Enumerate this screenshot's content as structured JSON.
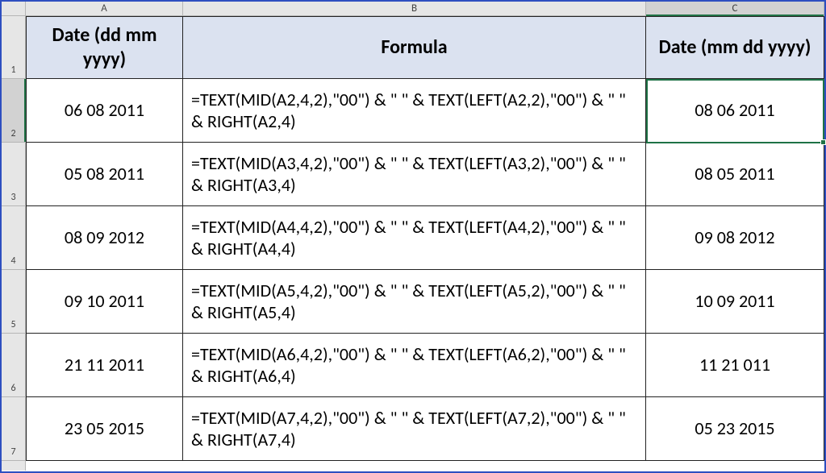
{
  "columns": {
    "letters": [
      "A",
      "B",
      "C"
    ],
    "selected_index": 2
  },
  "row_headers": {
    "numbers": [
      "1",
      "2",
      "3",
      "4",
      "5",
      "6",
      "7"
    ],
    "selected_index": 1
  },
  "header": {
    "colA": "Date (dd mm yyyy)",
    "colB": "Formula",
    "colC": "Date (mm dd yyyy)"
  },
  "rows": [
    {
      "date_in": "06 08 2011",
      "formula": "=TEXT(MID(A2,4,2),\"00\") & \" \" & TEXT(LEFT(A2,2),\"00\") & \" \" & RIGHT(A2,4)",
      "date_out": "08 06 2011"
    },
    {
      "date_in": "05 08 2011",
      "formula": "=TEXT(MID(A3,4,2),\"00\") & \" \" & TEXT(LEFT(A3,2),\"00\") & \" \" & RIGHT(A3,4)",
      "date_out": "08 05 2011"
    },
    {
      "date_in": "08 09 2012",
      "formula": "=TEXT(MID(A4,4,2),\"00\") & \" \" & TEXT(LEFT(A4,2),\"00\") & \" \" & RIGHT(A4,4)",
      "date_out": "09 08 2012"
    },
    {
      "date_in": "09 10 2011",
      "formula": "=TEXT(MID(A5,4,2),\"00\") & \" \" & TEXT(LEFT(A5,2),\"00\") & \" \" & RIGHT(A5,4)",
      "date_out": "10 09 2011"
    },
    {
      "date_in": "21 11 2011",
      "formula": "=TEXT(MID(A6,4,2),\"00\") & \" \" & TEXT(LEFT(A6,2),\"00\") & \" \" & RIGHT(A6,4)",
      "date_out": "11 21 011"
    },
    {
      "date_in": "23 05 2015",
      "formula": "=TEXT(MID(A7,4,2),\"00\") & \" \" & TEXT(LEFT(A7,2),\"00\") & \" \" & RIGHT(A7,4)",
      "date_out": "05 23 2015"
    }
  ],
  "selection": {
    "cell": "C2"
  }
}
